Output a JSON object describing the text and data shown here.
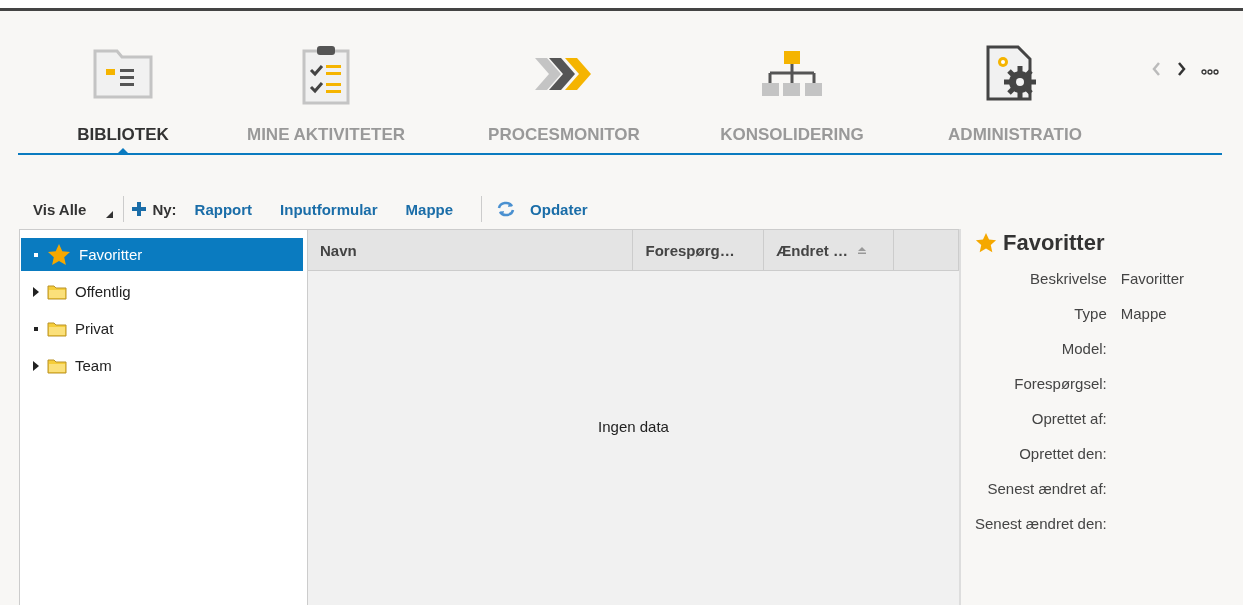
{
  "nav": {
    "tabs": [
      {
        "label": "BIBLIOTEK",
        "kind": "library",
        "selected": true
      },
      {
        "label": "MINE AKTIVITETER",
        "kind": "tasks",
        "selected": false
      },
      {
        "label": "PROCESMONITOR",
        "kind": "process",
        "selected": false
      },
      {
        "label": "KONSOLIDERING",
        "kind": "hierarchy",
        "selected": false
      },
      {
        "label": "ADMINISTRATIO",
        "kind": "admin",
        "selected": false
      }
    ],
    "controls": [
      {
        "kind": "prev",
        "disabled": true
      },
      {
        "kind": "next",
        "disabled": false
      },
      {
        "kind": "more",
        "disabled": false
      }
    ]
  },
  "toolbar": {
    "filter": "Vis Alle",
    "new_label": "Ny:",
    "new_items": [
      "Rapport",
      "Inputformular",
      "Mappe"
    ],
    "refresh": "Opdater"
  },
  "tree": {
    "items": [
      {
        "label": "Favoritter",
        "expandable": false,
        "kind": "star",
        "selected": true
      },
      {
        "label": "Offentlig",
        "expandable": true,
        "kind": "folder",
        "selected": false
      },
      {
        "label": "Privat",
        "expandable": false,
        "kind": "folder",
        "selected": false
      },
      {
        "label": "Team",
        "expandable": true,
        "kind": "folder",
        "selected": false
      }
    ]
  },
  "table": {
    "columns": [
      {
        "label": "Navn",
        "sorted": false
      },
      {
        "label": "Forespørg…",
        "sorted": false
      },
      {
        "label": "Ændret …",
        "sorted": true
      }
    ],
    "empty_text": "Ingen data"
  },
  "details": {
    "title": "Favoritter",
    "fields": [
      {
        "label": "Beskrivelse",
        "value": "Favoritter"
      },
      {
        "label": "Type",
        "value": "Mappe"
      },
      {
        "label": "Model:"
      },
      {
        "label": "Forespørgsel:"
      },
      {
        "label": "Oprettet af:"
      },
      {
        "label": "Oprettet den:"
      },
      {
        "label": "Senest ændret af:"
      },
      {
        "label": "Senest ændret den:"
      }
    ]
  }
}
